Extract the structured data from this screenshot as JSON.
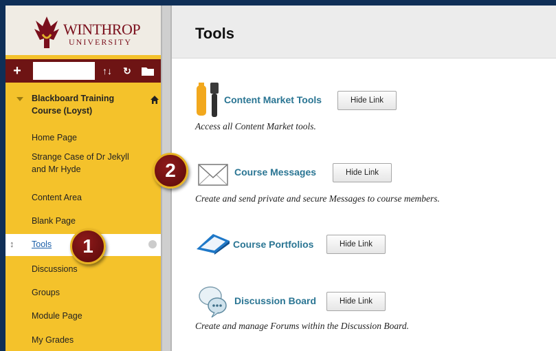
{
  "logo": {
    "name": "WINTHROP",
    "subtitle": "UNIVERSITY"
  },
  "toolbar": {
    "add_icon": "plus-icon",
    "sort_icon": "sort-icon",
    "refresh_icon": "refresh-icon",
    "folder_icon": "folder-icon",
    "plus_glyph": "+",
    "sort_glyph": "↑↓",
    "refresh_glyph": "↻"
  },
  "sidebar": {
    "course_title": "Blackboard Training Course (Loyst)",
    "items": [
      {
        "label": "Home Page"
      },
      {
        "label": "Strange Case of Dr Jekyll and Mr Hyde"
      },
      {
        "label": "Content Area"
      },
      {
        "label": "Blank Page"
      },
      {
        "label": "Tools",
        "selected": true
      },
      {
        "label": "Discussions"
      },
      {
        "label": "Groups"
      },
      {
        "label": "Module Page"
      },
      {
        "label": "My Grades"
      }
    ],
    "drag_glyph": "↕"
  },
  "main": {
    "title": "Tools",
    "tools": [
      {
        "name": "Content Market Tools",
        "button": "Hide Link",
        "description": "Access all Content Market tools.",
        "icon": "wrench-screwdriver-icon"
      },
      {
        "name": "Course Messages",
        "button": "Hide Link",
        "description": "Create and send private and secure Messages to course members.",
        "icon": "envelope-icon"
      },
      {
        "name": "Course Portfolios",
        "button": "Hide Link",
        "description": "",
        "icon": "portfolio-icon"
      },
      {
        "name": "Discussion Board",
        "button": "Hide Link",
        "description": "Create and manage Forums within the Discussion Board.",
        "icon": "speech-bubbles-icon"
      }
    ]
  },
  "callouts": {
    "first": "1",
    "second": "2"
  },
  "colors": {
    "sidebar_bg": "#f4c22b",
    "toolbar_bg": "#6e1414",
    "link": "#2a7593",
    "frame": "#0f2f57"
  }
}
